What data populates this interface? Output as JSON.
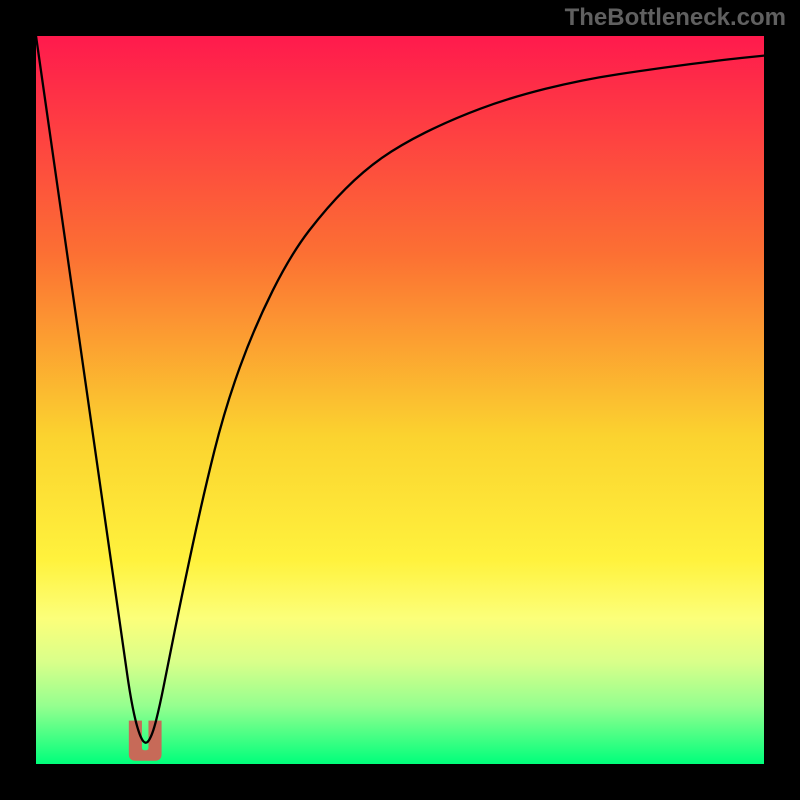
{
  "watermark": "TheBottleneck.com",
  "chart_data": {
    "type": "line",
    "title": "",
    "xlabel": "",
    "ylabel": "",
    "xlim": [
      0,
      100
    ],
    "ylim": [
      0,
      100
    ],
    "legend": false,
    "grid": false,
    "background_gradient_stops": [
      {
        "pct": 0,
        "color": "#ff1a4d"
      },
      {
        "pct": 30,
        "color": "#fc7033"
      },
      {
        "pct": 55,
        "color": "#fbd32f"
      },
      {
        "pct": 72,
        "color": "#fff23d"
      },
      {
        "pct": 80,
        "color": "#fcff7a"
      },
      {
        "pct": 86,
        "color": "#d9ff8a"
      },
      {
        "pct": 92,
        "color": "#95ff8f"
      },
      {
        "pct": 100,
        "color": "#00ff7b"
      }
    ],
    "series": [
      {
        "name": "curve",
        "stroke": "#000000",
        "stroke_width": 2.3,
        "x": [
          0,
          2,
          4,
          6,
          8,
          10,
          12,
          13,
          14,
          15,
          16,
          17,
          18,
          20,
          23,
          26,
          30,
          35,
          40,
          45,
          50,
          57,
          65,
          75,
          85,
          95,
          100
        ],
        "values": [
          100,
          86,
          72,
          58,
          44,
          30,
          16,
          9,
          4.5,
          2.5,
          4,
          8,
          13,
          23,
          37,
          49,
          60,
          70,
          76.5,
          81.5,
          85,
          88.5,
          91.5,
          94,
          95.5,
          96.8,
          97.3
        ]
      }
    ],
    "marker": {
      "name": "u-marker",
      "x": 15.0,
      "y": 3.2,
      "width": 4.5,
      "height": 5.5,
      "color": "#c76a58"
    }
  }
}
